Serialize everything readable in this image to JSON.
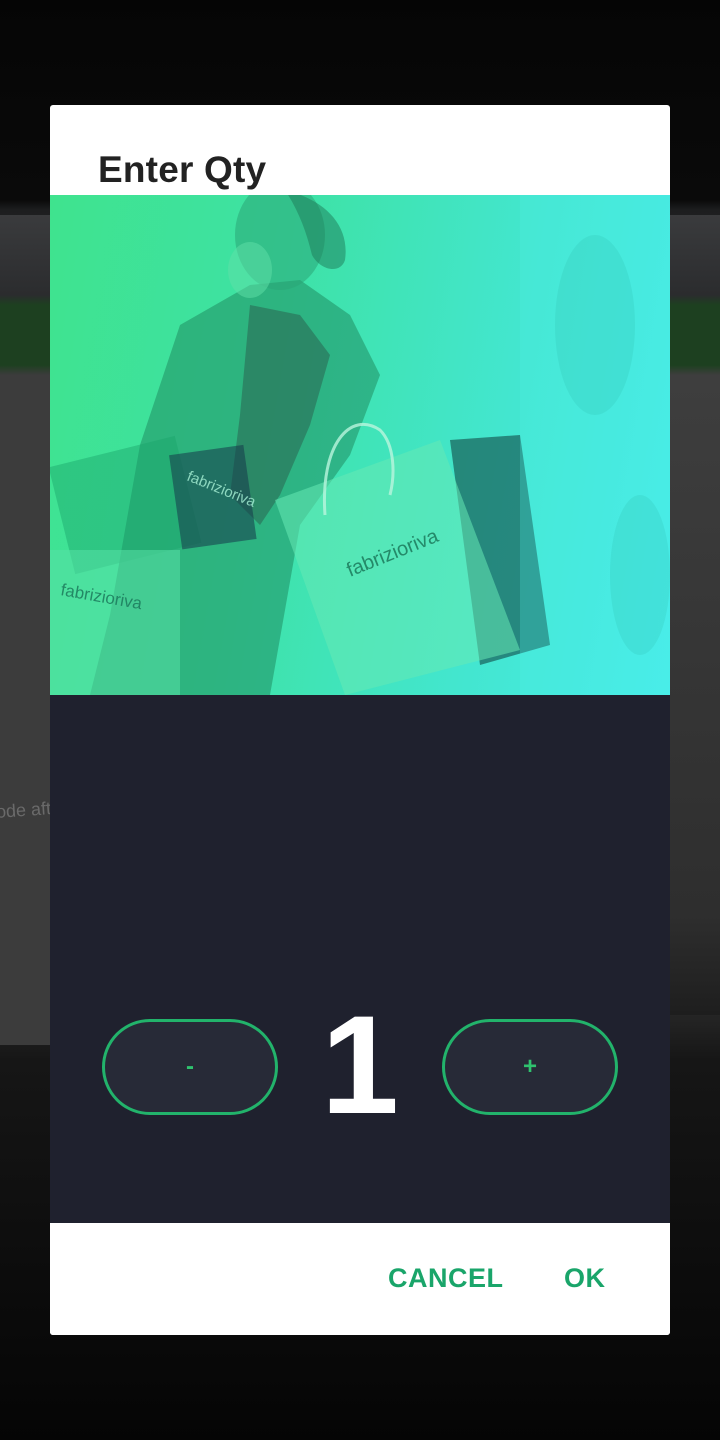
{
  "dialog": {
    "title": "Enter Qty",
    "hero_image": "shopping-woman-with-bags-photo",
    "hero_bag_brand": "fabrizioriva",
    "tint_colors": [
      "#3fe38e",
      "#47ecea"
    ],
    "quantity": "1",
    "decrement_label": "-",
    "increment_label": "+",
    "cancel_label": "CANCEL",
    "ok_label": "OK",
    "accent_color": "#1aa56a",
    "panel_color": "#1f212e"
  },
  "background": {
    "peek_text": "ode aft"
  }
}
